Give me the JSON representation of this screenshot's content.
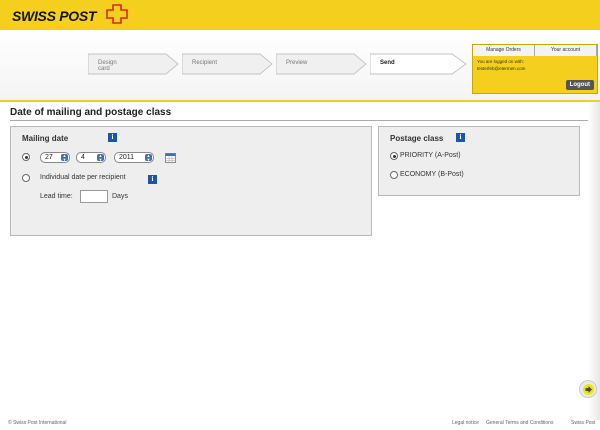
{
  "brand": {
    "logo_text": "SWISS POST",
    "accent_color": "#f5cf1d",
    "logo_icon": "swiss-cross-icon"
  },
  "steps": [
    {
      "label": "Design card",
      "active": false
    },
    {
      "label": "Recipient",
      "active": false
    },
    {
      "label": "Preview",
      "active": false
    },
    {
      "label": "Send",
      "active": true
    }
  ],
  "account": {
    "tabs": [
      "Manage Orders",
      "Your account"
    ],
    "logged_in_text": "You are logged on with:",
    "email": "testerfeb@etermen.com",
    "logout_label": "Logout"
  },
  "page_title": "Date of mailing and postage class",
  "mailing": {
    "title": "Mailing date",
    "info_icon": "info-icon",
    "day": "27",
    "month": "4",
    "year": "2011",
    "calendar_icon": "calendar-icon",
    "specific_date_selected": true,
    "individual_label": "Individual date per recipient",
    "individual_selected": false,
    "lead_time_label": "Lead time:",
    "lead_time_value": "",
    "days_label": "Days"
  },
  "postage": {
    "title": "Postage class",
    "info_icon": "info-icon",
    "options": [
      {
        "label": "PRIORITY (A-Post)",
        "selected": true
      },
      {
        "label": "ECONOMY (B-Post)",
        "selected": false
      }
    ]
  },
  "next_button_icon": "arrow-right-icon",
  "footer": {
    "copyright": "© Swiss Post International",
    "links": [
      "Legal notice",
      "General Terms and Conditions",
      "Swiss Post"
    ]
  }
}
